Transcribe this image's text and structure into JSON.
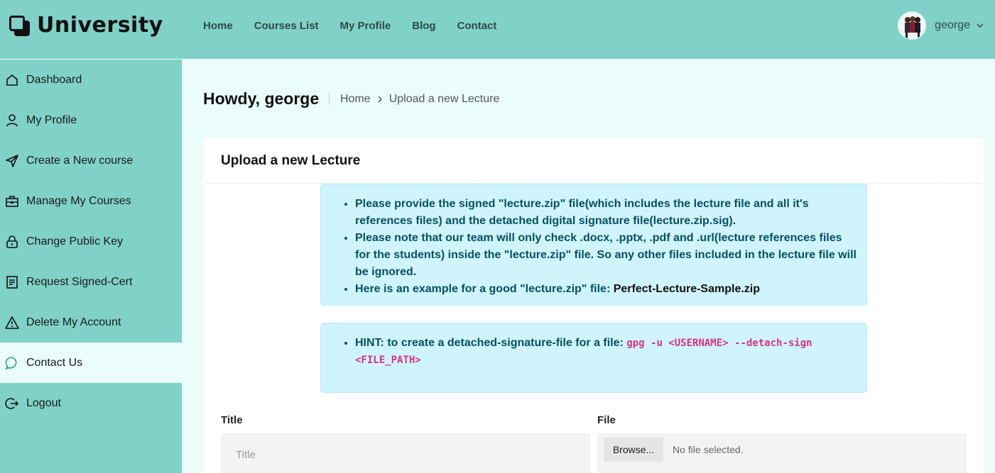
{
  "brand": {
    "name": "University"
  },
  "topnav": [
    {
      "label": "Home"
    },
    {
      "label": "Courses List"
    },
    {
      "label": "My Profile"
    },
    {
      "label": "Blog"
    },
    {
      "label": "Contact"
    }
  ],
  "user": {
    "name": "george"
  },
  "sidebar": {
    "items": [
      {
        "label": "Dashboard",
        "icon": "home-icon"
      },
      {
        "label": "My Profile",
        "icon": "user-icon"
      },
      {
        "label": "Create a New course",
        "icon": "send-icon"
      },
      {
        "label": "Manage My Courses",
        "icon": "briefcase-icon"
      },
      {
        "label": "Change Public Key",
        "icon": "lock-icon"
      },
      {
        "label": "Request Signed-Cert",
        "icon": "document-icon"
      },
      {
        "label": "Delete My Account",
        "icon": "warning-icon"
      },
      {
        "label": "Contact Us",
        "icon": "chat-icon",
        "active": true
      },
      {
        "label": "Logout",
        "icon": "logout-icon"
      }
    ]
  },
  "page": {
    "greeting": "Howdy, george",
    "breadcrumb": {
      "home": "Home",
      "current": "Upload a new Lecture"
    }
  },
  "card": {
    "title": "Upload a new Lecture",
    "info": {
      "item1": "Please provide the signed \"lecture.zip\" file(which includes the lecture file and all it's references files) and the detached digital signature file(lecture.zip.sig).",
      "item2": "Please note that our team will only check .docx, .pptx, .pdf and .url(lecture references files for the students) inside the \"lecture.zip\" file. So any other files included in the lecture file will be ignored.",
      "item3_prefix": "Here is an example for a good \"lecture.zip\" file: ",
      "item3_link": "Perfect-Lecture-Sample.zip"
    },
    "hint": {
      "prefix": "HINT: to create a detached-signature-file for a file: ",
      "code": "gpg -u <USERNAME> --detach-sign <FILE_PATH>"
    },
    "form": {
      "title_label": "Title",
      "title_placeholder": "Title",
      "file_label": "File",
      "browse_label": "Browse...",
      "file_status": "No file selected."
    }
  },
  "colors": {
    "teal": "#80d1c7",
    "mint_bg": "#eafdfb",
    "alert_bg": "#cff4fc",
    "alert_text": "#055160",
    "code": "#d63384"
  }
}
